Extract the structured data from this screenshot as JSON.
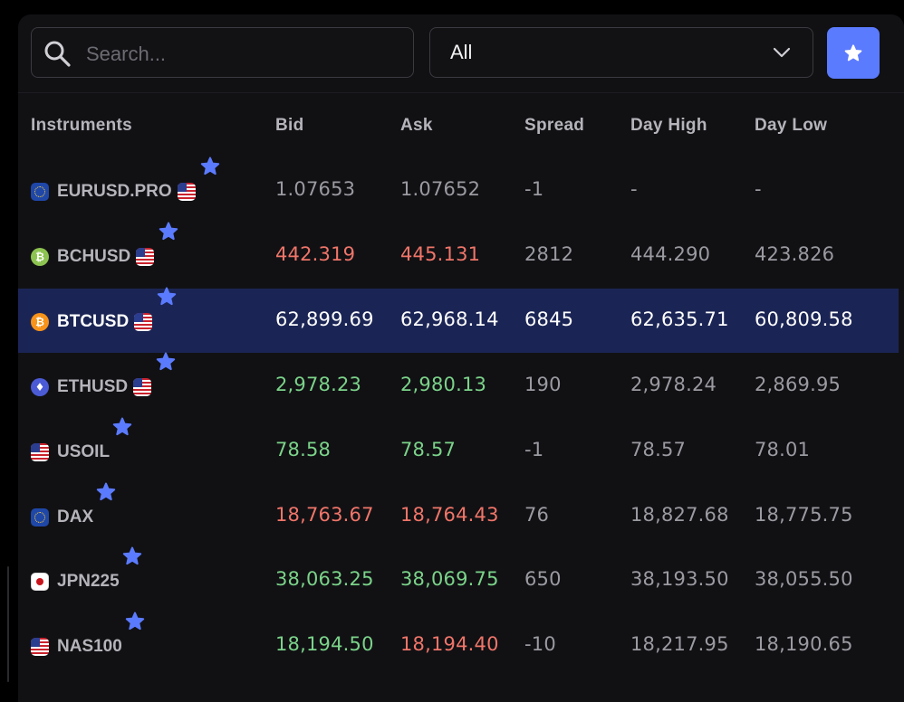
{
  "toolbar": {
    "search_placeholder": "Search...",
    "filter_value": "All",
    "icons": {
      "search": "search-icon",
      "filter": "chevron-down-icon",
      "favorites": "star-icon"
    }
  },
  "colors": {
    "accent": "#5b7bff",
    "up": "#7bd389",
    "down": "#f07569",
    "selected_row": "#1b2555",
    "background": "#111114"
  },
  "table": {
    "headers": {
      "instrument": "Instruments",
      "bid": "Bid",
      "ask": "Ask",
      "spread": "Spread",
      "day_high": "Day High",
      "day_low": "Day Low"
    },
    "rows": [
      {
        "name": "EURUSD.PRO",
        "icon": "eu-flag-icon",
        "second_flag": "us-flag-icon",
        "bid": "1.07653",
        "ask": "1.07652",
        "spread": "-1",
        "high": "-",
        "low": "-",
        "bid_trend": "neutral",
        "ask_trend": "neutral",
        "favorite": true,
        "selected": false
      },
      {
        "name": "BCHUSD",
        "icon": "bitcoin-cash-icon",
        "second_flag": "us-flag-icon",
        "bid": "442.319",
        "ask": "445.131",
        "spread": "2812",
        "high": "444.290",
        "low": "423.826",
        "bid_trend": "down",
        "ask_trend": "down",
        "favorite": true,
        "selected": false
      },
      {
        "name": "BTCUSD",
        "icon": "bitcoin-icon",
        "second_flag": "us-flag-icon",
        "bid": "62,899.69",
        "ask": "62,968.14",
        "spread": "6845",
        "high": "62,635.71",
        "low": "60,809.58",
        "bid_trend": "down",
        "ask_trend": "down",
        "favorite": true,
        "selected": true
      },
      {
        "name": "ETHUSD",
        "icon": "ethereum-icon",
        "second_flag": "us-flag-icon",
        "bid": "2,978.23",
        "ask": "2,980.13",
        "spread": "190",
        "high": "2,978.24",
        "low": "2,869.95",
        "bid_trend": "up",
        "ask_trend": "up",
        "favorite": true,
        "selected": false
      },
      {
        "name": "USOIL",
        "icon": "us-flag-icon",
        "second_flag": null,
        "bid": "78.58",
        "ask": "78.57",
        "spread": "-1",
        "high": "78.57",
        "low": "78.01",
        "bid_trend": "up",
        "ask_trend": "up",
        "favorite": true,
        "selected": false
      },
      {
        "name": "DAX",
        "icon": "eu-flag-icon",
        "second_flag": null,
        "bid": "18,763.67",
        "ask": "18,764.43",
        "spread": "76",
        "high": "18,827.68",
        "low": "18,775.75",
        "bid_trend": "down",
        "ask_trend": "down",
        "favorite": true,
        "selected": false
      },
      {
        "name": "JPN225",
        "icon": "japan-flag-icon",
        "second_flag": null,
        "bid": "38,063.25",
        "ask": "38,069.75",
        "spread": "650",
        "high": "38,193.50",
        "low": "38,055.50",
        "bid_trend": "up",
        "ask_trend": "up",
        "favorite": true,
        "selected": false
      },
      {
        "name": "NAS100",
        "icon": "us-flag-icon",
        "second_flag": null,
        "bid": "18,194.50",
        "ask": "18,194.40",
        "spread": "-10",
        "high": "18,217.95",
        "low": "18,190.65",
        "bid_trend": "up",
        "ask_trend": "down",
        "favorite": true,
        "selected": false
      }
    ]
  }
}
